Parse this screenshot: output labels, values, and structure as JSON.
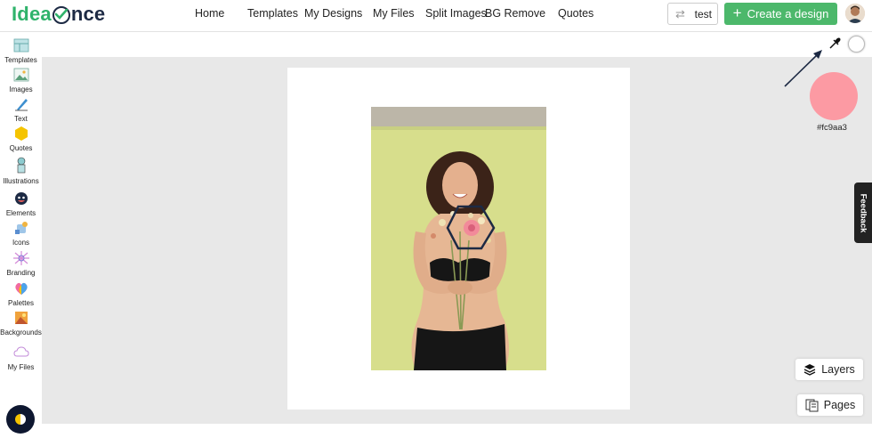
{
  "header": {
    "logo_part1": "Idea",
    "logo_part2": "nce",
    "nav": [
      "Home",
      "Templates",
      "My Designs",
      "My Files",
      "Split Images",
      "BG Remove",
      "Quotes"
    ],
    "workspace_switch_label": "test",
    "create_button_label": "Create a design"
  },
  "sidebar": {
    "items": [
      {
        "label": "Templates",
        "icon": "templates-icon"
      },
      {
        "label": "Images",
        "icon": "images-icon"
      },
      {
        "label": "Text",
        "icon": "text-icon"
      },
      {
        "label": "Quotes",
        "icon": "quotes-icon"
      },
      {
        "label": "Illustrations",
        "icon": "illustrations-icon"
      },
      {
        "label": "Elements",
        "icon": "elements-icon"
      },
      {
        "label": "Icons",
        "icon": "icons-icon"
      },
      {
        "label": "Branding",
        "icon": "branding-icon"
      },
      {
        "label": "Palettes",
        "icon": "palettes-icon"
      },
      {
        "label": "Backgrounds",
        "icon": "backgrounds-icon"
      },
      {
        "label": "My Files",
        "icon": "my-files-icon"
      }
    ]
  },
  "color_picker": {
    "selected_color": "#fc9aa3",
    "selected_label": "#fc9aa3"
  },
  "feedback_label": "Feedback",
  "layers_label": "Layers",
  "pages_label": "Pages",
  "colors": {
    "brand_green": "#4cb86b",
    "workspace_bg": "#e8e8e8",
    "photo_bg": "#d7de8c"
  }
}
